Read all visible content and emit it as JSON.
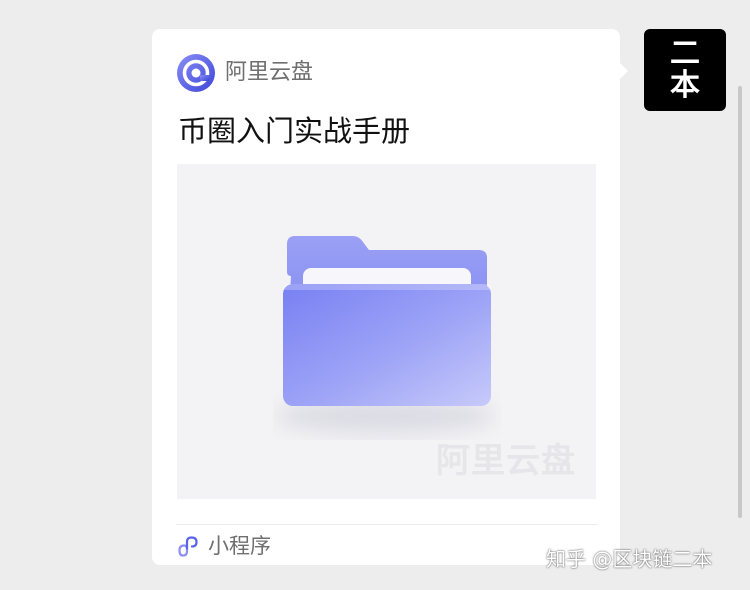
{
  "message": {
    "source_app": "阿里云盘",
    "title": "币圈入门实战手册",
    "preview_watermark": "阿里云盘",
    "footer_label": "小程序",
    "icons": {
      "source_logo": "aliyun-drive-logo-icon",
      "preview": "folder-icon",
      "footer": "mini-program-icon"
    }
  },
  "sender": {
    "avatar_line1": "二",
    "avatar_line2": "本"
  },
  "page_watermark": "知乎 @区块链二本",
  "colors": {
    "page_background": "#ededed",
    "card_background": "#ffffff",
    "folder_accent": "#7b84f2",
    "logo_accent": "#5b63e8"
  }
}
